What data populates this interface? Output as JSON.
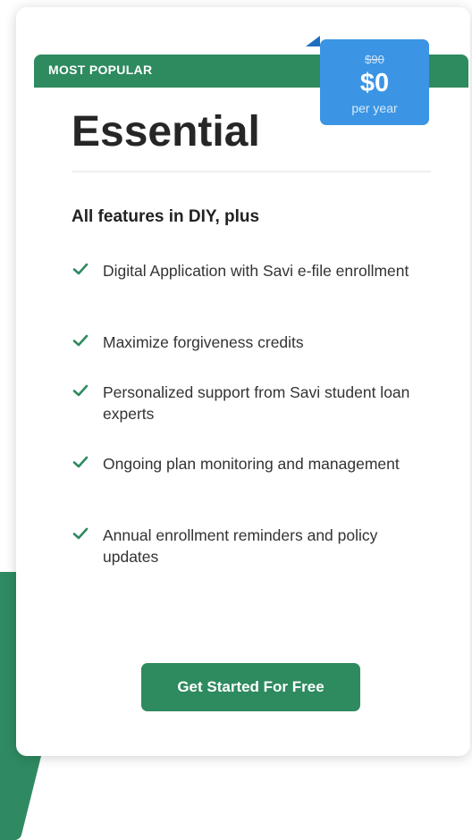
{
  "ribbon": {
    "label": "MOST POPULAR"
  },
  "price": {
    "original": "$90",
    "current": "$0",
    "period": "per year"
  },
  "plan": {
    "name": "Essential"
  },
  "features": {
    "heading": "All features in DIY, plus",
    "items": [
      {
        "text": "Digital Application with Savi e-file enrollment",
        "icon": "check-icon"
      },
      {
        "text": "Maximize forgiveness credits",
        "icon": "check-icon"
      },
      {
        "text": "Personalized support from Savi student loan experts",
        "icon": "check-icon"
      },
      {
        "text": "Ongoing plan monitoring and management",
        "icon": "check-icon"
      },
      {
        "text": "Annual enrollment reminders and policy updates",
        "icon": "check-icon"
      }
    ]
  },
  "cta": {
    "label": "Get Started For Free"
  },
  "colors": {
    "brand_green": "#2e8a5f",
    "price_blue": "#3b95e4",
    "text_dark": "#262626"
  }
}
